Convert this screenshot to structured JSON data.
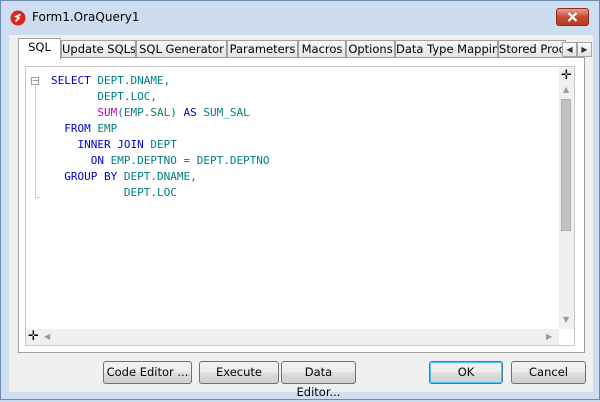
{
  "window": {
    "title": "Form1.OraQuery1"
  },
  "tabs": [
    "SQL",
    "Update SQLs",
    "SQL Generator",
    "Parameters",
    "Macros",
    "Options",
    "Data Type Mapping",
    "Stored Proc"
  ],
  "tab_scroll": {
    "left": "◀",
    "right": "▶"
  },
  "editor": {
    "lines": [
      [
        {
          "t": "SELECT ",
          "c": "kw"
        },
        {
          "t": "DEPT.DNAME,",
          "c": "id"
        }
      ],
      [
        {
          "t": "       DEPT.LOC,",
          "c": "id"
        }
      ],
      [
        {
          "t": "       ",
          "c": "id"
        },
        {
          "t": "SUM",
          "c": "fn"
        },
        {
          "t": "(EMP.SAL) ",
          "c": "id"
        },
        {
          "t": "AS ",
          "c": "kw"
        },
        {
          "t": "SUM_SAL",
          "c": "id"
        }
      ],
      [
        {
          "t": "  FROM ",
          "c": "kw"
        },
        {
          "t": "EMP",
          "c": "id"
        }
      ],
      [
        {
          "t": "    INNER JOIN ",
          "c": "kw"
        },
        {
          "t": "DEPT",
          "c": "id"
        }
      ],
      [
        {
          "t": "      ON ",
          "c": "kw"
        },
        {
          "t": "EMP.DEPTNO = DEPT.DEPTNO",
          "c": "id"
        }
      ],
      [
        {
          "t": "  GROUP BY ",
          "c": "kw"
        },
        {
          "t": "DEPT.DNAME,",
          "c": "id"
        }
      ],
      [
        {
          "t": "           DEPT.LOC",
          "c": "id"
        }
      ]
    ]
  },
  "buttons": {
    "code_editor": "Code Editor ...",
    "execute": "Execute",
    "data_editor": "Data Editor...",
    "ok": "OK",
    "cancel": "Cancel"
  },
  "icons": {
    "fold": "−",
    "split": "✛",
    "arrow_up": "▲",
    "arrow_down": "▼",
    "arrow_left": "◀",
    "arrow_right": "▶"
  }
}
